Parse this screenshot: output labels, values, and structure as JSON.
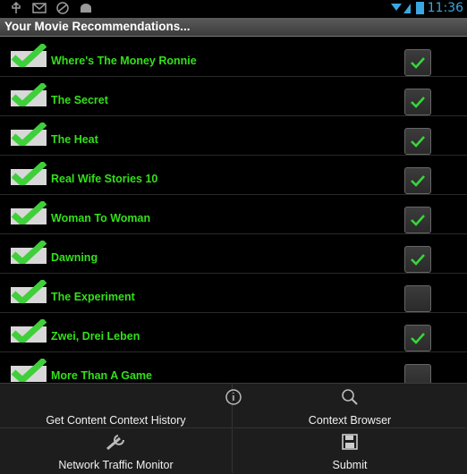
{
  "status_bar": {
    "left_icons": [
      "usb-icon",
      "mail-icon",
      "sync-icon",
      "android-debug-icon"
    ],
    "time": "11:36",
    "colors": {
      "accent": "#3aa7e0"
    }
  },
  "app_title": "Your Movie Recommendations...",
  "movies": [
    {
      "title": "Where's The Money Ronnie",
      "checked": true
    },
    {
      "title": "The Secret",
      "checked": true
    },
    {
      "title": "The Heat",
      "checked": true
    },
    {
      "title": "Real Wife Stories 10",
      "checked": true
    },
    {
      "title": "Woman To Woman",
      "checked": true
    },
    {
      "title": "Dawning",
      "checked": true
    },
    {
      "title": "The Experiment",
      "checked": false
    },
    {
      "title": "Zwei, Drei Leben",
      "checked": true
    },
    {
      "title": "More Than A Game",
      "checked": false
    }
  ],
  "menu": {
    "items": [
      {
        "label": "Get Content Context History",
        "icon": "info-icon"
      },
      {
        "label": "Context Browser",
        "icon": "search-icon"
      },
      {
        "label": "Network Traffic Monitor",
        "icon": "wrench-icon"
      },
      {
        "label": "Submit",
        "icon": "save-icon"
      }
    ]
  },
  "colors": {
    "title_text": "#33e019",
    "check_green": "#36d63a",
    "background": "#000000"
  }
}
